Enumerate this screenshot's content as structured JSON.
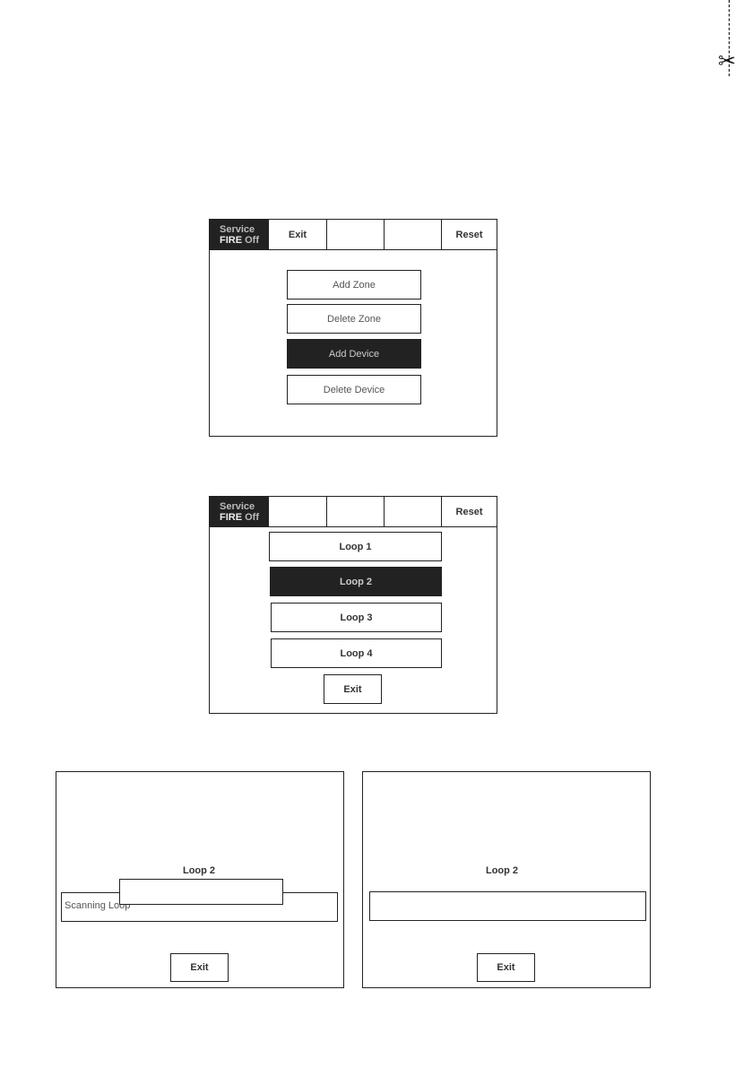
{
  "screen1": {
    "status": {
      "line1": "Service",
      "fire": "FIRE",
      "off": "Off"
    },
    "topbar": {
      "exit": "Exit",
      "reset": "Reset"
    },
    "menu": [
      "Add Zone",
      "Delete Zone",
      "Add Device",
      "Delete Device"
    ],
    "selected_index": 2
  },
  "screen2": {
    "status": {
      "line1": "Service",
      "fire": "FIRE",
      "off": "Off"
    },
    "topbar": {
      "reset": "Reset"
    },
    "loops": [
      "Loop 1",
      "Loop 2",
      "Loop 3",
      "Loop 4"
    ],
    "selected_index": 1,
    "exit_label": "Exit"
  },
  "screen3": {
    "title": "Loop 2",
    "status_text": "Scanning Loop",
    "exit_label": "Exit"
  },
  "screen4": {
    "title": "Loop 2",
    "exit_label": "Exit"
  },
  "colors": {
    "dark": "#222222",
    "border": "#222222",
    "text": "#333333"
  },
  "icons": {
    "cut_mark": "scissors-icon"
  }
}
